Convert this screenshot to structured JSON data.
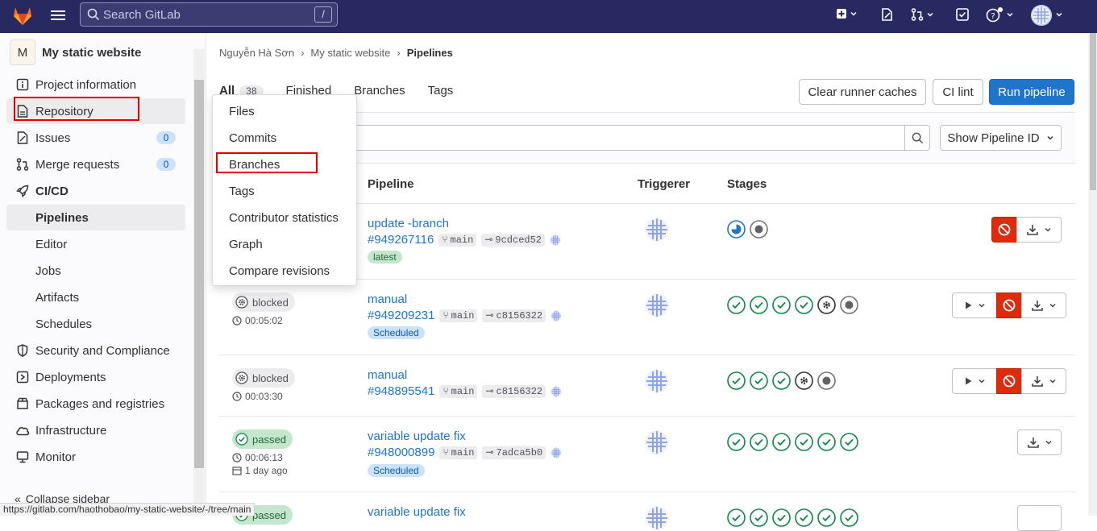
{
  "topbar": {
    "search_placeholder": "Search GitLab",
    "search_shortcut": "/"
  },
  "sidebar": {
    "project_initial": "M",
    "project_name": "My static website",
    "items": [
      {
        "label": "Project information",
        "icon": "info-icon"
      },
      {
        "label": "Repository",
        "icon": "document-icon"
      },
      {
        "label": "Issues",
        "icon": "issues-icon",
        "badge": "0"
      },
      {
        "label": "Merge requests",
        "icon": "merge-request-icon",
        "badge": "0"
      },
      {
        "label": "CI/CD",
        "icon": "rocket-icon"
      },
      {
        "label": "Pipelines"
      },
      {
        "label": "Editor"
      },
      {
        "label": "Jobs"
      },
      {
        "label": "Artifacts"
      },
      {
        "label": "Schedules"
      },
      {
        "label": "Security and Compliance",
        "icon": "shield-icon"
      },
      {
        "label": "Deployments",
        "icon": "deployments-icon"
      },
      {
        "label": "Packages and registries",
        "icon": "package-icon"
      },
      {
        "label": "Infrastructure",
        "icon": "cloud-icon"
      },
      {
        "label": "Monitor",
        "icon": "monitor-icon"
      }
    ],
    "collapse_label": "Collapse sidebar"
  },
  "breadcrumb": [
    "Nguyễn Hà Sơn",
    "My static website",
    "Pipelines"
  ],
  "tabs": {
    "all": "All",
    "all_count": "38",
    "finished": "Finished",
    "branches": "Branches",
    "tags": "Tags"
  },
  "buttons": {
    "clear_caches": "Clear runner caches",
    "ci_lint": "CI lint",
    "run_pipeline": "Run pipeline",
    "show_pipeline_id": "Show Pipeline ID"
  },
  "table_headers": {
    "pipeline": "Pipeline",
    "triggerer": "Triggerer",
    "stages": "Stages"
  },
  "dropdown": [
    "Files",
    "Commits",
    "Branches",
    "Tags",
    "Contributor statistics",
    "Graph",
    "Compare revisions"
  ],
  "rows": [
    {
      "title": "update -branch",
      "id": "#949267116",
      "branch": "main",
      "commit": "9cdced52",
      "tag": "latest",
      "status": "",
      "duration": "",
      "ago": ""
    },
    {
      "title": "manual",
      "id": "#949209231",
      "branch": "main",
      "commit": "c8156322",
      "tag": "Scheduled",
      "status": "blocked",
      "duration": "00:05:02",
      "ago": ""
    },
    {
      "title": "manual",
      "id": "#948895541",
      "branch": "main",
      "commit": "c8156322",
      "tag": "",
      "status": "blocked",
      "duration": "00:03:30",
      "ago": ""
    },
    {
      "title": "variable update fix",
      "id": "#948000899",
      "branch": "main",
      "commit": "7adca5b0",
      "tag": "Scheduled",
      "status": "passed",
      "duration": "00:06:13",
      "ago": "1 day ago"
    },
    {
      "title": "variable update fix",
      "status": "passed"
    }
  ],
  "status_url": "https://gitlab.com/haothobao/my-static-website/-/tree/main",
  "colors": {
    "topbar": "#292961",
    "primary": "#1f75cb",
    "danger": "#dd2b0e",
    "success": "#108548"
  }
}
